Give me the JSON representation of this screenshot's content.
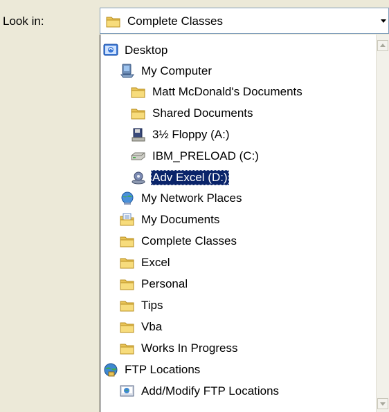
{
  "look_in": {
    "label": "Look in:",
    "selected_value": "Complete Classes",
    "selected_icon": "folder-icon"
  },
  "items": [
    {
      "label": "Desktop",
      "icon": "desktop-icon"
    },
    {
      "label": "My Computer",
      "icon": "computer-icon"
    },
    {
      "label": "Matt McDonald's Documents",
      "icon": "folder-icon"
    },
    {
      "label": "Shared Documents",
      "icon": "folder-icon"
    },
    {
      "label": "3½ Floppy (A:)",
      "icon": "floppy-drive-icon"
    },
    {
      "label": "IBM_PRELOAD (C:)",
      "icon": "hard-drive-icon"
    },
    {
      "label": "Adv Excel  (D:)",
      "icon": "removable-drive-icon",
      "selected": true
    },
    {
      "label": "My Network Places",
      "icon": "network-icon"
    },
    {
      "label": "My Documents",
      "icon": "documents-folder-icon"
    },
    {
      "label": "Complete Classes",
      "icon": "folder-icon"
    },
    {
      "label": "Excel",
      "icon": "folder-icon"
    },
    {
      "label": "Personal",
      "icon": "folder-icon"
    },
    {
      "label": "Tips",
      "icon": "folder-icon"
    },
    {
      "label": "Vba",
      "icon": "folder-icon"
    },
    {
      "label": "Works In Progress",
      "icon": "folder-icon"
    },
    {
      "label": "FTP Locations",
      "icon": "ftp-icon"
    },
    {
      "label": "Add/Modify FTP Locations",
      "icon": "ftp-add-icon"
    }
  ],
  "colors": {
    "selection_bg": "#0a246a",
    "selection_text": "#ffffff",
    "folder": "#f5d76e",
    "window_bg": "#ece9d8"
  }
}
